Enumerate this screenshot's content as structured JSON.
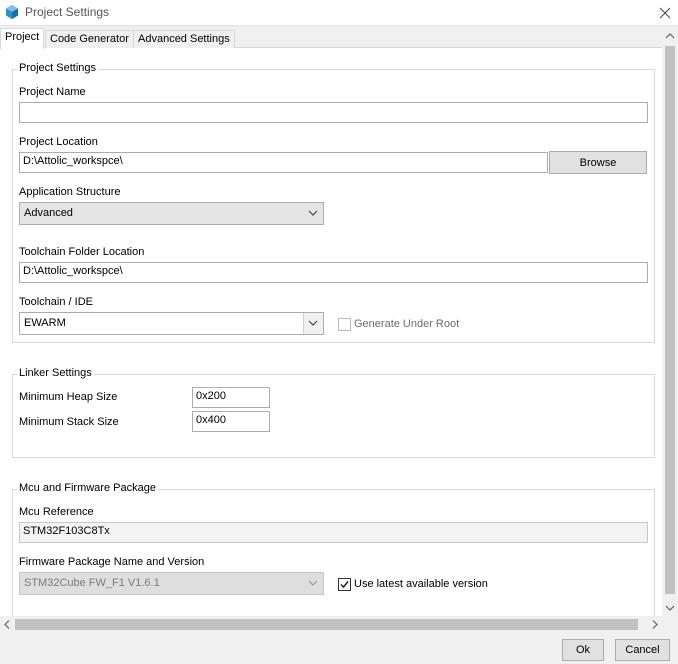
{
  "window": {
    "title": "Project Settings",
    "icon": "cube-icon"
  },
  "tabs": [
    {
      "label": "Project",
      "active": true
    },
    {
      "label": "Code Generator",
      "active": false
    },
    {
      "label": "Advanced Settings",
      "active": false
    }
  ],
  "project_settings": {
    "group_title": "Project Settings",
    "project_name_label": "Project Name",
    "project_name_value": "",
    "project_location_label": "Project Location",
    "project_location_value": "D:\\Attolic_workspce\\",
    "browse_label": "Browse",
    "app_structure_label": "Application Structure",
    "app_structure_value": "Advanced",
    "toolchain_folder_label": "Toolchain Folder Location",
    "toolchain_folder_value": "D:\\Attolic_workspce\\",
    "toolchain_ide_label": "Toolchain / IDE",
    "toolchain_ide_value": "EWARM",
    "generate_under_root_label": "Generate Under Root",
    "generate_under_root_checked": false
  },
  "linker_settings": {
    "group_title": "Linker Settings",
    "min_heap_label": "Minimum Heap Size",
    "min_heap_value": "0x200",
    "min_stack_label": "Minimum Stack Size",
    "min_stack_value": "0x400"
  },
  "mcu_firmware": {
    "group_title": "Mcu and Firmware Package",
    "mcu_reference_label": "Mcu Reference",
    "mcu_reference_value": "STM32F103C8Tx",
    "firmware_label": "Firmware Package Name and Version",
    "firmware_value": "STM32Cube FW_F1 V1.6.1",
    "use_latest_label": "Use latest available version",
    "use_latest_checked": true
  },
  "dialog_buttons": {
    "ok": "Ok",
    "cancel": "Cancel"
  },
  "colors": {
    "accent_icon": "#2b8fd6",
    "thumb": "#c1c1c1",
    "border": "#adadad"
  }
}
